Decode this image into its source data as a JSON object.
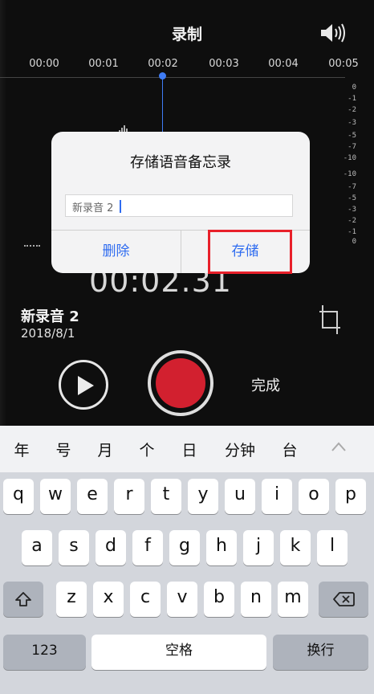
{
  "header": {
    "title": "录制",
    "speaker_icon": "speaker-icon"
  },
  "timeline": {
    "ticks": [
      "00:00",
      "00:01",
      "00:02",
      "00:03",
      "00:04",
      "00:05"
    ],
    "playhead_color": "#3f7cf5"
  },
  "db_scale": [
    "0",
    "-1",
    "-2",
    "-3",
    "-5",
    "-7",
    "-10",
    "-10",
    "-7",
    "-5",
    "-3",
    "-2",
    "-1",
    "0"
  ],
  "readout": {
    "time": "00:02.31"
  },
  "recording": {
    "name": "新录音 2",
    "date": "2018/8/1"
  },
  "controls": {
    "done_label": "完成",
    "record_color": "#d2202f"
  },
  "dialog": {
    "title": "存储语音备忘录",
    "input_value": "新录音 2",
    "delete_label": "删除",
    "save_label": "存储",
    "button_color": "#2f6cf0",
    "highlight_color": "#e8202a"
  },
  "keyboard": {
    "suggestions": [
      "年",
      "号",
      "月",
      "个",
      "日",
      "分钟",
      "台"
    ],
    "row1": [
      "q",
      "w",
      "e",
      "r",
      "t",
      "y",
      "u",
      "i",
      "o",
      "p"
    ],
    "row2": [
      "a",
      "s",
      "d",
      "f",
      "g",
      "h",
      "j",
      "k",
      "l"
    ],
    "row3": [
      "z",
      "x",
      "c",
      "v",
      "b",
      "n",
      "m"
    ],
    "numbers_label": "123",
    "space_label": "空格",
    "return_label": "换行"
  }
}
